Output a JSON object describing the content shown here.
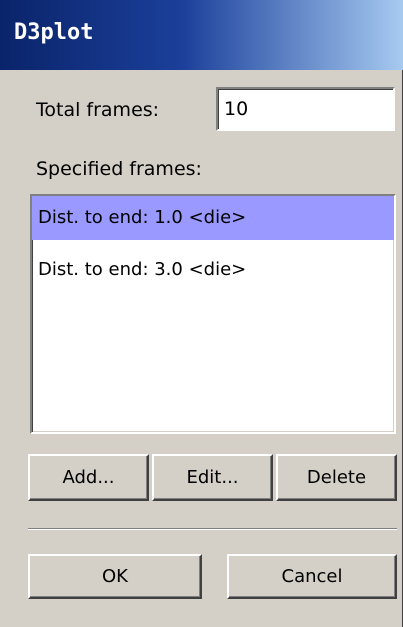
{
  "window": {
    "title": "D3plot"
  },
  "total_frames": {
    "label": "Total frames:",
    "value": "10"
  },
  "specified_frames": {
    "label": "Specified frames:",
    "items": [
      {
        "text": "Dist. to end: 1.0 <die>",
        "selected": true
      },
      {
        "text": "Dist. to end: 3.0 <die>",
        "selected": false
      }
    ]
  },
  "actions": {
    "add_label": "Add...",
    "edit_label": "Edit...",
    "delete_label": "Delete"
  },
  "footer": {
    "ok_label": "OK",
    "cancel_label": "Cancel"
  },
  "colors": {
    "selection": "#9999ff",
    "titlebar": "#0a246a",
    "dialog_bg": "#d4d0c8"
  }
}
